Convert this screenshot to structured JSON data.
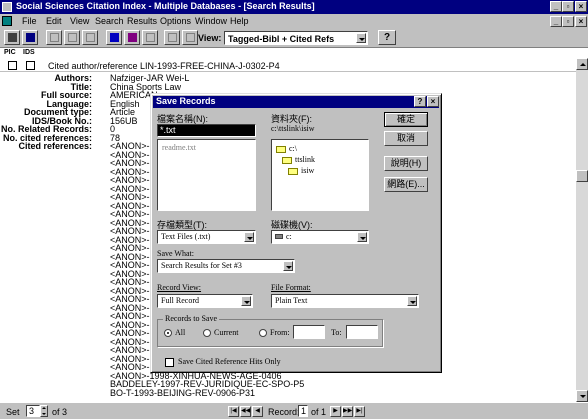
{
  "window": {
    "title": "Social Sciences Citation Index  - Multiple Databases - [Search Results]"
  },
  "menu": {
    "items": [
      "File",
      "Edit",
      "View",
      "Search",
      "Results",
      "Options",
      "Window",
      "Help"
    ]
  },
  "toolbar": {
    "view_label": "View:",
    "view_value": "Tagged-Bibl + Cited Refs"
  },
  "results": {
    "col_pic": "PIC",
    "col_ids": "IDS",
    "record_header": "Cited author/reference  LIN-1993-FREE-CHINA-J-0302-P4"
  },
  "record": {
    "fields": [
      {
        "label": "Authors:",
        "value": "Nafziger-JAR Wei-L"
      },
      {
        "label": "Title:",
        "value": "China Sports Law"
      },
      {
        "label": "Full source:",
        "value": "AMERICAN"
      },
      {
        "label": "Language:",
        "value": "English"
      },
      {
        "label": "Document type:",
        "value": "Article"
      },
      {
        "label": "IDS/Book No.:",
        "value": "156UB"
      },
      {
        "label": "No. Related Records:",
        "value": "0"
      },
      {
        "label": "No. cited references:",
        "value": "78"
      },
      {
        "label": "Cited references:",
        "value": "<ANON>-1"
      }
    ],
    "anon_refs": [
      "<ANON>-1",
      "<ANON>-1",
      "<ANON>-1",
      "<ANON>-1",
      "<ANON>-1",
      "<ANON>-1",
      "<ANON>-1",
      "<ANON>-1",
      "<ANON>-1",
      "<ANON>-1",
      "<ANON>-1",
      "<ANON>-1",
      "<ANON>-1",
      "<ANON>-1",
      "<ANON>-1",
      "<ANON>-1",
      "<ANON>-1",
      "<ANON>-1",
      "<ANON>-1",
      "<ANON>-1",
      "<ANON>-1",
      "<ANON>-1",
      "<ANON>-1",
      "<ANON>-1",
      "<ANON>-1",
      "<ANON>-1"
    ],
    "tail_refs": [
      "<ANON>-1998-XINHUA-NEWS-AGE-0406",
      "BADDELEY-1997-REV-JURIDIQUE-EC-SPO-P5",
      "BO-T-1993-BEIJING-REV-0906-P31"
    ]
  },
  "statusbar": {
    "set_label": "Set",
    "set_value": "3",
    "set_total": "of 3",
    "record_label": "Record:",
    "record_value": "1",
    "record_total": "of 1"
  },
  "dialog": {
    "title": "Save Records",
    "filename_label": "檔案名稱(N):",
    "filename_value": "*.txt",
    "filelist": [
      "readme.txt"
    ],
    "folders_label": "資料夾(F):",
    "folders_path": "c:\\ttslink\\isiw",
    "folders": [
      "c:\\",
      "ttslink",
      "isiw"
    ],
    "ok": "確定",
    "cancel": "取消",
    "help": "說明(H)",
    "network": "網路(E)...",
    "filetype_label": "存檔類型(T):",
    "filetype_value": "Text Files (.txt)",
    "drive_label": "磁碟機(V):",
    "drive_value": "c:",
    "save_what_label": "Save What:",
    "save_what_value": "Search Results for Set #3",
    "record_view_label": "Record View:",
    "record_view_value": "Full Record",
    "file_format_label": "File Format:",
    "file_format_value": "Plain Text",
    "records_group": "Records to Save",
    "radio_all": "All",
    "radio_current": "Current",
    "radio_from": "From:",
    "to_label": "To:",
    "checkbox_label": "Save Cited Reference Hits Only"
  }
}
